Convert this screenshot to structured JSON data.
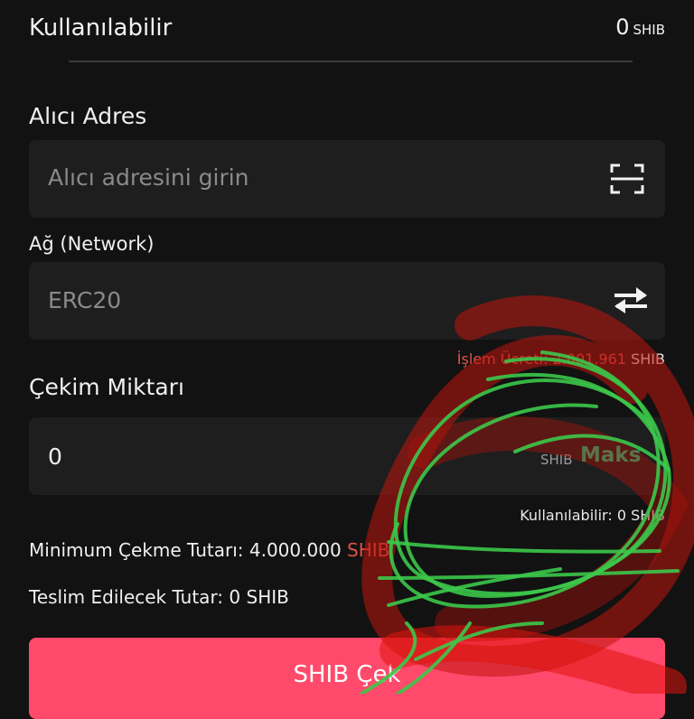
{
  "balance": {
    "label": "Kullanılabilir",
    "value": "0",
    "currency": "SHIB"
  },
  "recipient": {
    "label": "Alıcı Adres",
    "placeholder": "Alıcı adresini girin",
    "scan_icon": "scan-icon"
  },
  "network": {
    "label": "Ağ (Network)",
    "value": "ERC20",
    "switch_icon": "swap-arrows-icon"
  },
  "fee": {
    "label": "İşlem Ücreti:",
    "value": "2.001.961",
    "currency": "SHIB"
  },
  "amount": {
    "label": "Çekim Miktarı",
    "value": "0",
    "currency": "SHIB",
    "max_label": "Maks",
    "available_label": "Kullanılabilir:",
    "available_value": "0",
    "available_currency": "SHIB"
  },
  "minimum": {
    "label": "Minimum Çekme Tutarı:",
    "value": "4.000.000",
    "currency": "SHIB"
  },
  "delivered": {
    "label": "Teslim Edilecek Tutar:",
    "value": "0",
    "currency": "SHIB"
  },
  "submit": {
    "label": "SHIB Çek"
  },
  "colors": {
    "background": "#121212",
    "field": "#1e1e1e",
    "accent_button": "#ff4a6b",
    "max_green": "#1bc47d",
    "warning_red": "#e0524a",
    "scribble_green": "#3cc84a",
    "scribble_red": "#c0140c"
  }
}
